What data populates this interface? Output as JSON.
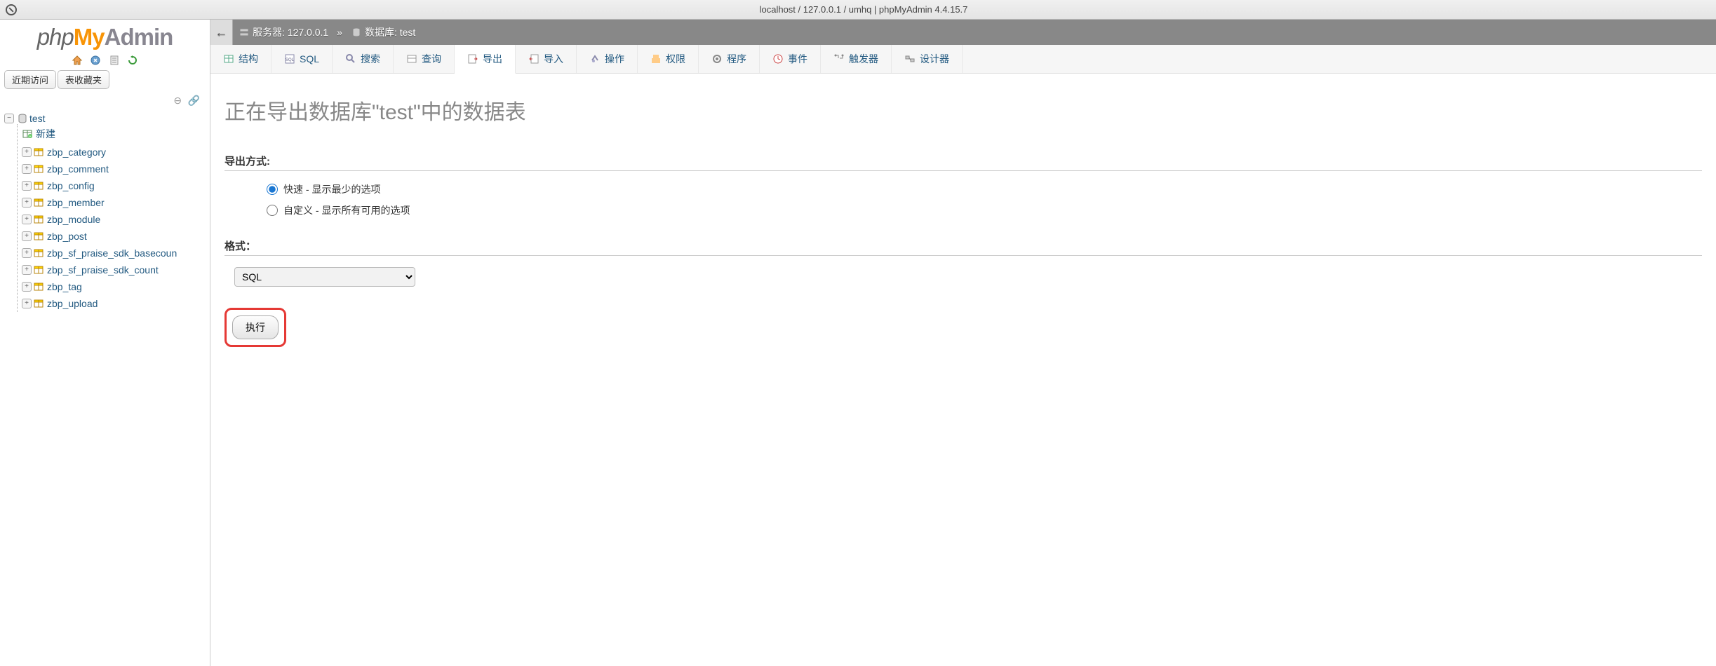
{
  "titlebar": "localhost / 127.0.0.1 / umhq | phpMyAdmin 4.4.15.7",
  "logo": {
    "php": "php",
    "my": "My",
    "admin": "Admin"
  },
  "sidebar": {
    "tab_recent": "近期访问",
    "tab_favorites": "表收藏夹",
    "db_name": "test",
    "new_label": "新建",
    "tables": [
      "zbp_category",
      "zbp_comment",
      "zbp_config",
      "zbp_member",
      "zbp_module",
      "zbp_post",
      "zbp_sf_praise_sdk_basecoun",
      "zbp_sf_praise_sdk_count",
      "zbp_tag",
      "zbp_upload"
    ]
  },
  "breadcrumb": {
    "server_label": "服务器:",
    "server_value": "127.0.0.1",
    "db_label": "数据库:",
    "db_value": "test",
    "sep": "»"
  },
  "tabs": [
    {
      "label": "结构"
    },
    {
      "label": "SQL"
    },
    {
      "label": "搜索"
    },
    {
      "label": "查询"
    },
    {
      "label": "导出"
    },
    {
      "label": "导入"
    },
    {
      "label": "操作"
    },
    {
      "label": "权限"
    },
    {
      "label": "程序"
    },
    {
      "label": "事件"
    },
    {
      "label": "触发器"
    },
    {
      "label": "设计器"
    }
  ],
  "page": {
    "title": "正在导出数据库\"test\"中的数据表",
    "export_method_label": "导出方式:",
    "quick_option": "快速 - 显示最少的选项",
    "custom_option": "自定义 - 显示所有可用的选项",
    "format_label": "格式：",
    "format_selected": "SQL",
    "submit": "执行"
  }
}
